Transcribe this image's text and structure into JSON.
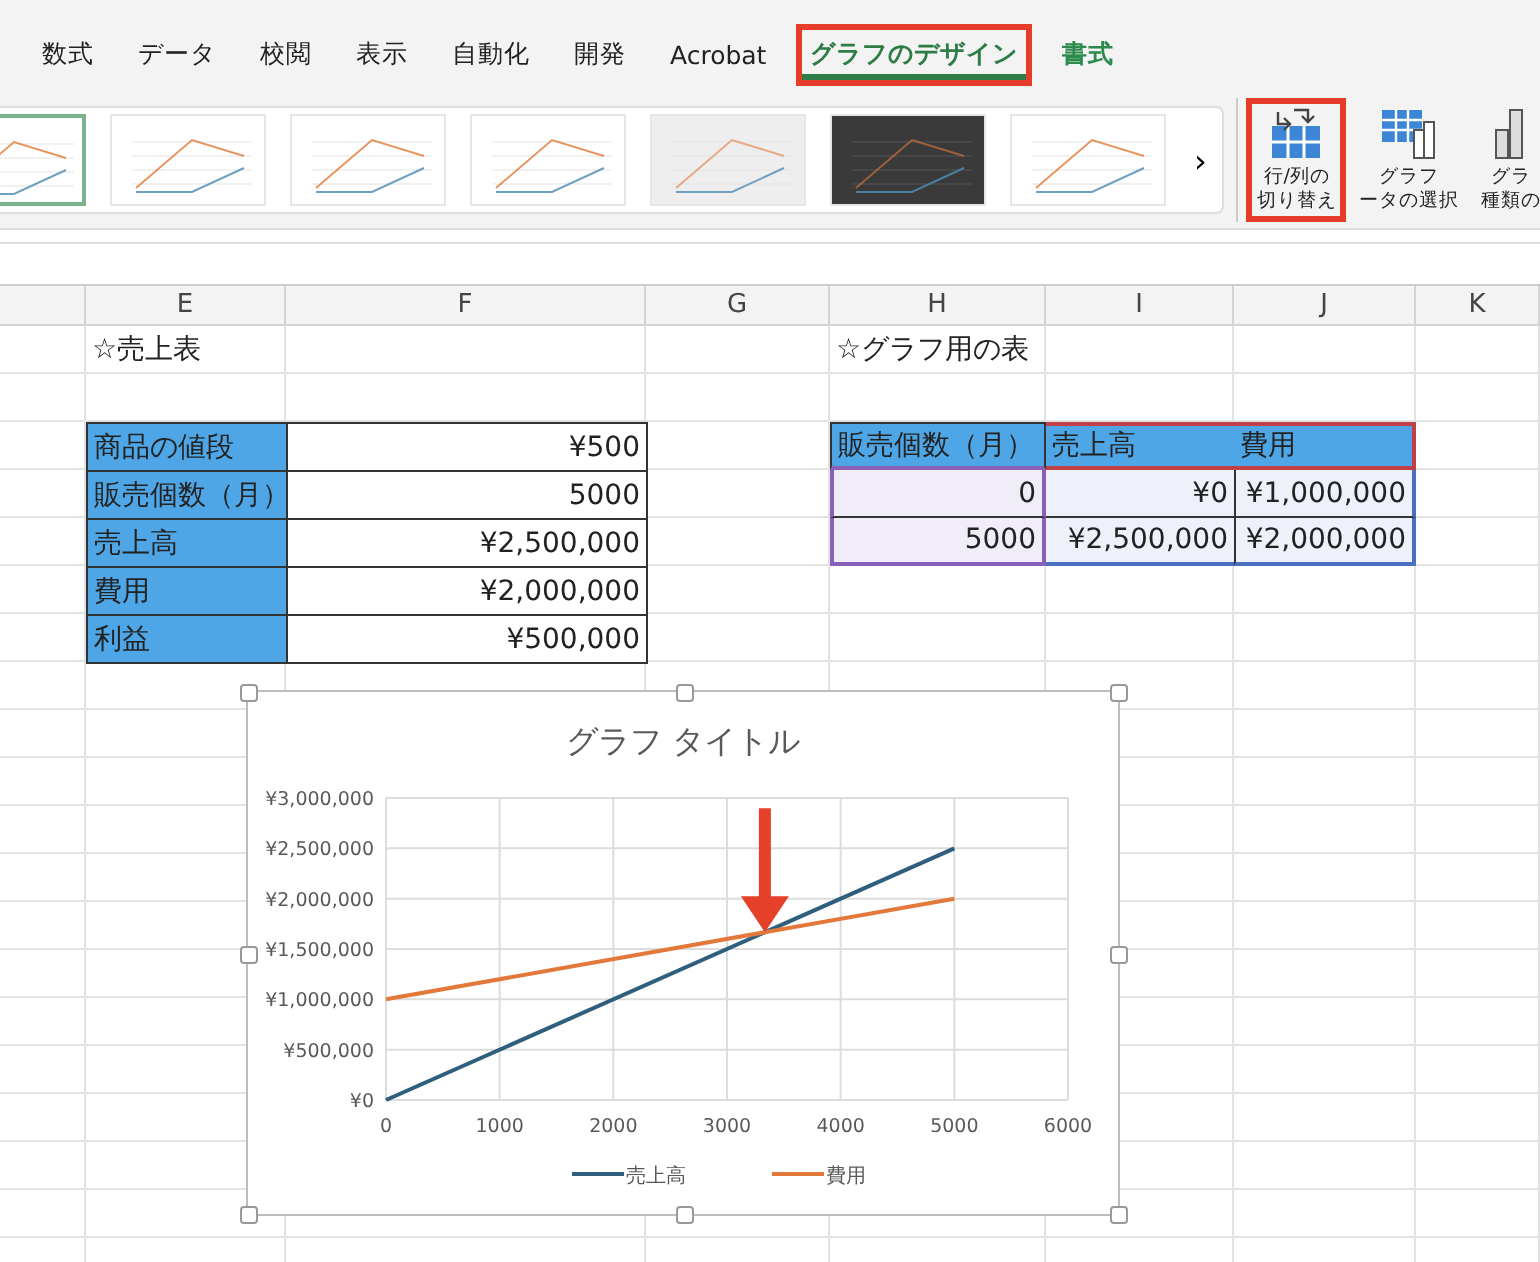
{
  "ribbon_tabs": [
    {
      "label": "数式",
      "selected": false,
      "kind": "normal",
      "highlighted": false
    },
    {
      "label": "データ",
      "selected": false,
      "kind": "normal",
      "highlighted": false
    },
    {
      "label": "校閲",
      "selected": false,
      "kind": "normal",
      "highlighted": false
    },
    {
      "label": "表示",
      "selected": false,
      "kind": "normal",
      "highlighted": false
    },
    {
      "label": "自動化",
      "selected": false,
      "kind": "normal",
      "highlighted": false
    },
    {
      "label": "開発",
      "selected": false,
      "kind": "normal",
      "highlighted": false
    },
    {
      "label": "Acrobat",
      "selected": false,
      "kind": "normal",
      "highlighted": false
    },
    {
      "label": "グラフのデザイン",
      "selected": true,
      "kind": "contextual",
      "highlighted": true
    },
    {
      "label": "書式",
      "selected": false,
      "kind": "contextual",
      "highlighted": false
    }
  ],
  "chart_styles": [
    {
      "kind": "light",
      "selected": true
    },
    {
      "kind": "light",
      "selected": false
    },
    {
      "kind": "light",
      "selected": false
    },
    {
      "kind": "light",
      "selected": false
    },
    {
      "kind": "shaded",
      "selected": false
    },
    {
      "kind": "dark",
      "selected": false
    },
    {
      "kind": "light",
      "selected": false
    }
  ],
  "gallery_more": "›",
  "ribbon_buttons": [
    {
      "kind": "switch",
      "lines": [
        "行/列の",
        "切り替え"
      ],
      "highlighted": true
    },
    {
      "kind": "data",
      "lines": [
        "グラフ",
        "ータの選択"
      ],
      "highlighted": false
    },
    {
      "kind": "type",
      "lines": [
        "グラ",
        "種類の"
      ],
      "highlighted": false
    }
  ],
  "columns": [
    "",
    "E",
    "F",
    "G",
    "H",
    "I",
    "J",
    "K"
  ],
  "sales_table": {
    "title": "☆売上表",
    "rows": [
      {
        "label": "商品の値段",
        "value": "¥500"
      },
      {
        "label": "販売個数（月）",
        "value": "5000"
      },
      {
        "label": "売上高",
        "value": "¥2,500,000"
      },
      {
        "label": "費用",
        "value": "¥2,000,000"
      },
      {
        "label": "利益",
        "value": "¥500,000"
      }
    ]
  },
  "graph_table": {
    "title": "☆グラフ用の表",
    "columns": [
      "販売個数（月）",
      "売上高",
      "費用"
    ],
    "rows": [
      [
        "0",
        "¥0",
        "¥1,000,000"
      ],
      [
        "5000",
        "¥2,500,000",
        "¥2,000,000"
      ]
    ]
  },
  "chart": {
    "selected": true,
    "chart_data": {
      "type": "line",
      "title": "グラフ タイトル",
      "x": [
        0,
        5000
      ],
      "series": [
        {
          "name": "売上高",
          "color": "#2f5f7c",
          "values": [
            0,
            2500000
          ]
        },
        {
          "name": "費用",
          "color": "#e2793a",
          "values": [
            1000000,
            2000000
          ]
        }
      ],
      "xlim": [
        0,
        6000
      ],
      "ylim": [
        0,
        3000000
      ],
      "xticks": [
        0,
        1000,
        2000,
        3000,
        4000,
        5000,
        6000
      ],
      "yticks": [
        {
          "value": 0,
          "label": "¥0"
        },
        {
          "value": 500000,
          "label": "¥500,000"
        },
        {
          "value": 1000000,
          "label": "¥1,000,000"
        },
        {
          "value": 1500000,
          "label": "¥1,500,000"
        },
        {
          "value": 2000000,
          "label": "¥2,000,000"
        },
        {
          "value": 2500000,
          "label": "¥2,500,000"
        },
        {
          "value": 3000000,
          "label": "¥3,000,000"
        }
      ],
      "grid": true,
      "legend": true
    },
    "intersection_arrow": true
  }
}
